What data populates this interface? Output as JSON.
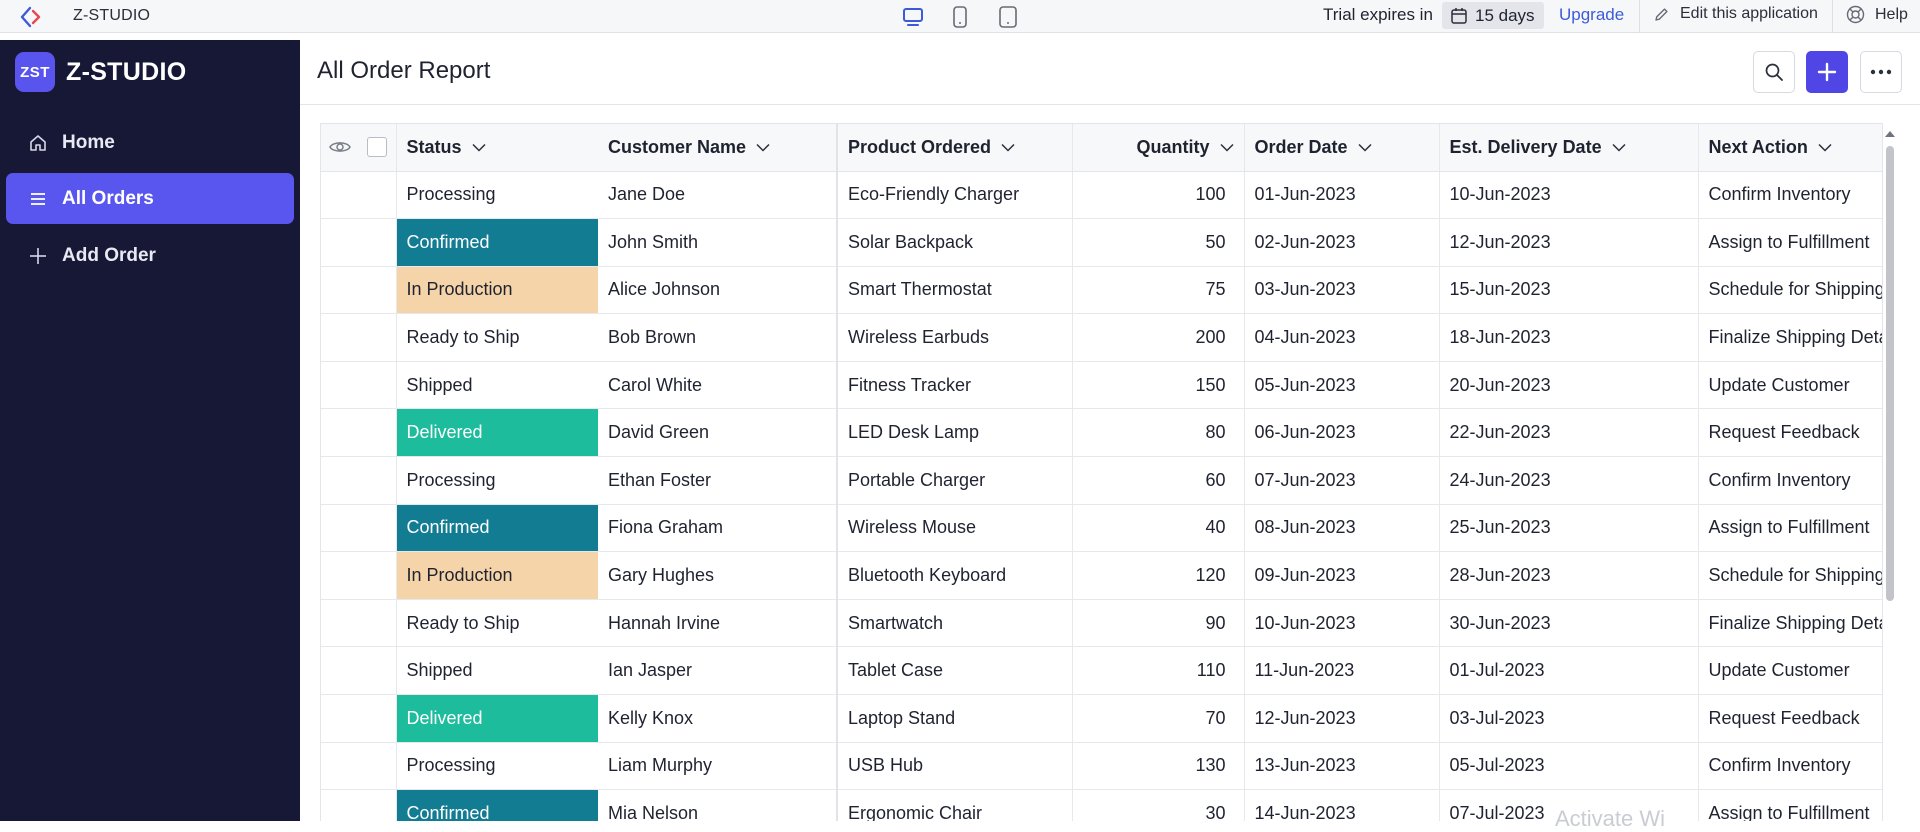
{
  "topbar": {
    "app_name": "Z-STUDIO",
    "trial_label": "Trial expires in",
    "trial_days": "15 days",
    "upgrade_label": "Upgrade",
    "edit_label": "Edit this application",
    "help_label": "Help",
    "devices": [
      "desktop-icon",
      "phone-icon",
      "tablet-icon"
    ]
  },
  "sidebar": {
    "logo_text": "ZST",
    "brand_name": "Z-STUDIO",
    "items": [
      {
        "label": "Home",
        "icon": "home-icon",
        "active": false
      },
      {
        "label": "All Orders",
        "icon": "list-icon",
        "active": true
      },
      {
        "label": "Add Order",
        "icon": "plus-icon",
        "active": false
      }
    ]
  },
  "header": {
    "title": "All Order Report",
    "buttons": [
      "search-icon",
      "plus-icon",
      "more-icon"
    ]
  },
  "table": {
    "columns": [
      "Status",
      "Customer Name",
      "Product Ordered",
      "Quantity",
      "Order Date",
      "Est. Delivery Date",
      "Next Action"
    ],
    "rows": [
      {
        "status": "Processing",
        "customer": "Jane Doe",
        "product": "Eco-Friendly Charger",
        "quantity": "100",
        "order_date": "01-Jun-2023",
        "delivery_date": "10-Jun-2023",
        "next_action": "Confirm Inventory"
      },
      {
        "status": "Confirmed",
        "customer": "John Smith",
        "product": "Solar Backpack",
        "quantity": "50",
        "order_date": "02-Jun-2023",
        "delivery_date": "12-Jun-2023",
        "next_action": "Assign to Fulfillment"
      },
      {
        "status": "In Production",
        "customer": "Alice Johnson",
        "product": "Smart Thermostat",
        "quantity": "75",
        "order_date": "03-Jun-2023",
        "delivery_date": "15-Jun-2023",
        "next_action": "Schedule for Shipping"
      },
      {
        "status": "Ready to Ship",
        "customer": "Bob Brown",
        "product": "Wireless Earbuds",
        "quantity": "200",
        "order_date": "04-Jun-2023",
        "delivery_date": "18-Jun-2023",
        "next_action": "Finalize Shipping Deta"
      },
      {
        "status": "Shipped",
        "customer": "Carol White",
        "product": "Fitness Tracker",
        "quantity": "150",
        "order_date": "05-Jun-2023",
        "delivery_date": "20-Jun-2023",
        "next_action": "Update Customer"
      },
      {
        "status": "Delivered",
        "customer": "David Green",
        "product": "LED Desk Lamp",
        "quantity": "80",
        "order_date": "06-Jun-2023",
        "delivery_date": "22-Jun-2023",
        "next_action": "Request Feedback"
      },
      {
        "status": "Processing",
        "customer": "Ethan Foster",
        "product": "Portable Charger",
        "quantity": "60",
        "order_date": "07-Jun-2023",
        "delivery_date": "24-Jun-2023",
        "next_action": "Confirm Inventory"
      },
      {
        "status": "Confirmed",
        "customer": "Fiona Graham",
        "product": "Wireless Mouse",
        "quantity": "40",
        "order_date": "08-Jun-2023",
        "delivery_date": "25-Jun-2023",
        "next_action": "Assign to Fulfillment"
      },
      {
        "status": "In Production",
        "customer": "Gary Hughes",
        "product": "Bluetooth Keyboard",
        "quantity": "120",
        "order_date": "09-Jun-2023",
        "delivery_date": "28-Jun-2023",
        "next_action": "Schedule for Shipping"
      },
      {
        "status": "Ready to Ship",
        "customer": "Hannah Irvine",
        "product": "Smartwatch",
        "quantity": "90",
        "order_date": "10-Jun-2023",
        "delivery_date": "30-Jun-2023",
        "next_action": "Finalize Shipping Deta"
      },
      {
        "status": "Shipped",
        "customer": "Ian Jasper",
        "product": "Tablet Case",
        "quantity": "110",
        "order_date": "11-Jun-2023",
        "delivery_date": "01-Jul-2023",
        "next_action": "Update Customer"
      },
      {
        "status": "Delivered",
        "customer": "Kelly Knox",
        "product": "Laptop Stand",
        "quantity": "70",
        "order_date": "12-Jun-2023",
        "delivery_date": "03-Jul-2023",
        "next_action": "Request Feedback"
      },
      {
        "status": "Processing",
        "customer": "Liam Murphy",
        "product": "USB Hub",
        "quantity": "130",
        "order_date": "13-Jun-2023",
        "delivery_date": "05-Jul-2023",
        "next_action": "Confirm Inventory"
      },
      {
        "status": "Confirmed",
        "customer": "Mia Nelson",
        "product": "Ergonomic Chair",
        "quantity": "30",
        "order_date": "14-Jun-2023",
        "delivery_date": "07-Jul-2023",
        "next_action": "Assign to Fulfillment"
      }
    ]
  },
  "watermark": "Activate Wi",
  "colors": {
    "sidebar_bg": "#161836",
    "accent": "#5956ef",
    "status_confirmed": "#127c93",
    "status_in_production": "#f6d4a9",
    "status_delivered": "#1dbc9c"
  }
}
